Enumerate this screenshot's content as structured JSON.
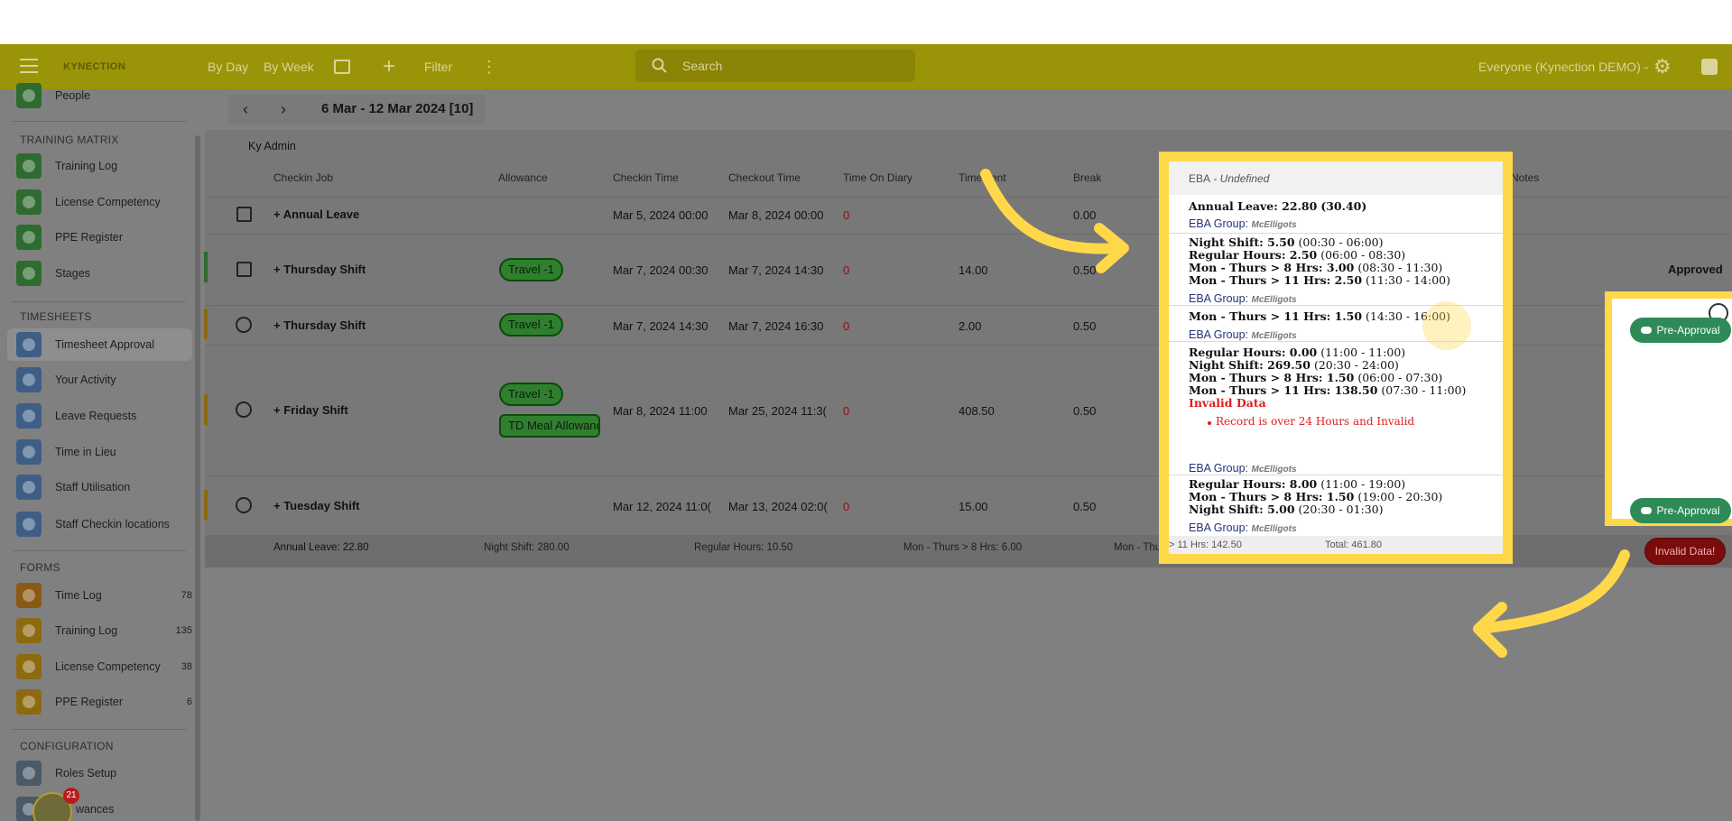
{
  "topbar": {
    "brand": "KYNECTION",
    "by_day": "By Day",
    "by_week": "By Week",
    "filter": "Filter",
    "search_placeholder": "Search",
    "account": "Everyone (Kynection DEMO) -"
  },
  "sidebar": {
    "top_item": "People",
    "training_matrix_heading": "TRAINING MATRIX",
    "training_matrix": [
      "Training Log",
      "License Competency",
      "PPE Register",
      "Stages"
    ],
    "timesheets_heading": "TIMESHEETS",
    "timesheets": [
      "Timesheet Approval",
      "Your Activity",
      "Leave Requests",
      "Time in Lieu",
      "Staff Utilisation",
      "Staff Checkin locations"
    ],
    "forms_heading": "FORMS",
    "forms": [
      {
        "label": "Time Log",
        "count": "78"
      },
      {
        "label": "Training Log",
        "count": "135"
      },
      {
        "label": "License Competency",
        "count": "38"
      },
      {
        "label": "PPE Register",
        "count": "6"
      }
    ],
    "configuration_heading": "CONFIGURATION",
    "configuration": [
      "Roles Setup",
      "wances"
    ],
    "badge_count": "21"
  },
  "main": {
    "date_range": "6 Mar - 12 Mar 2024 [10]",
    "person": "Ky Admin",
    "headers": {
      "job": "Checkin Job",
      "allowance": "Allowance",
      "checkin": "Checkin Time",
      "checkout": "Checkout Time",
      "time_on_diary": "Time On Diary",
      "time_spent": "Time",
      "time_spent_tail": "ent",
      "break": "Break",
      "notes": "Notes"
    },
    "rows": [
      {
        "job": "+ Annual Leave",
        "checkin": "Mar 5, 2024 00:00",
        "checkout": "Mar 8, 2024 00:00",
        "diary": "0",
        "spent": "",
        "break": "0.00"
      },
      {
        "job": "+ Thursday Shift",
        "allowances": [
          "Travel -1"
        ],
        "checkin": "Mar 7, 2024 00:30",
        "checkout": "Mar 7, 2024 14:30",
        "diary": "0",
        "spent": "14.00",
        "break": "0.50"
      },
      {
        "job": "+ Thursday Shift",
        "allowances": [
          "Travel -1"
        ],
        "checkin": "Mar 7, 2024 14:30",
        "checkout": "Mar 7, 2024 16:30",
        "diary": "0",
        "spent": "2.00",
        "break": "0.50"
      },
      {
        "job": "+ Friday Shift",
        "allowances": [
          "Travel -1",
          "TD Meal Allowanc"
        ],
        "checkin": "Mar 8, 2024 11:00",
        "checkout": "Mar 25, 2024 11:3(",
        "diary": "0",
        "spent": "408.50",
        "break": "0.50"
      },
      {
        "job": "+ Tuesday Shift",
        "checkin": "Mar 12, 2024 11:0(",
        "checkout": "Mar 13, 2024 02:0(",
        "diary": "0",
        "spent": "15.00",
        "break": "0.50"
      }
    ],
    "totals": {
      "annual_leave": "Annual Leave: 22.80",
      "night_shift": "Night Shift: 280.00",
      "regular_hours": "Regular Hours: 10.50",
      "mon_thurs_8": "Mon - Thurs > 8 Hrs: 6.00",
      "mon_thurs_11_head": "Mon - Thu",
      "mon_thurs_11_tail": "> 11 Hrs: 142.50",
      "total": "Total: 461.80"
    },
    "approved_label": "Approved",
    "pre_approval_label": "Pre-Approval",
    "invalid_label": "Invalid Data!"
  },
  "popover": {
    "header_eba": "EBA",
    "header_state": " - Undefined",
    "group_label": "EBA Group:",
    "group_name": "McElligots",
    "annual_leave_label": "Annual Leave: 22.80",
    "annual_leave_extra": "(30.40)",
    "block1": [
      {
        "label": "Night Shift: 5.50",
        "range": "(00:30 - 06:00)"
      },
      {
        "label": "Regular Hours: 2.50",
        "range": "(06:00 - 08:30)"
      },
      {
        "label": "Mon - Thurs > 8 Hrs: 3.00",
        "range": "(08:30 - 11:30)"
      },
      {
        "label": "Mon - Thurs > 11 Hrs: 2.50",
        "range": "(11:30 - 14:00)"
      }
    ],
    "block2": [
      {
        "label": "Mon - Thurs > 11 Hrs: 1.50",
        "range": "(14:30 - 16:00)"
      }
    ],
    "block3": [
      {
        "label": "Regular Hours: 0.00",
        "range": "(11:00 - 11:00)"
      },
      {
        "label": "Night Shift: 269.50",
        "range": "(20:30 - 24:00)"
      },
      {
        "label": "Mon - Thurs > 8 Hrs: 1.50",
        "range": "(06:00 - 07:30)"
      },
      {
        "label": "Mon - Thurs > 11 Hrs: 138.50",
        "range": "(07:30 - 11:00)"
      }
    ],
    "invalid_title": "Invalid Data",
    "invalid_reason": "Record is over 24 Hours and Invalid",
    "block4": [
      {
        "label": "Regular Hours: 8.00",
        "range": "(11:00 - 19:00)"
      },
      {
        "label": "Mon - Thurs > 8 Hrs: 1.50",
        "range": "(19:00 - 20:30)"
      },
      {
        "label": "Night Shift: 5.00",
        "range": "(20:30 - 01:30)"
      }
    ],
    "foot_left": "> 11 Hrs: 142.50",
    "foot_right": "Total: 461.80"
  },
  "colors": {
    "topbar": "#9a9408",
    "highlight": "#ffd84a",
    "pre_approval": "#2e8b57",
    "invalid": "#7a0c0c"
  }
}
